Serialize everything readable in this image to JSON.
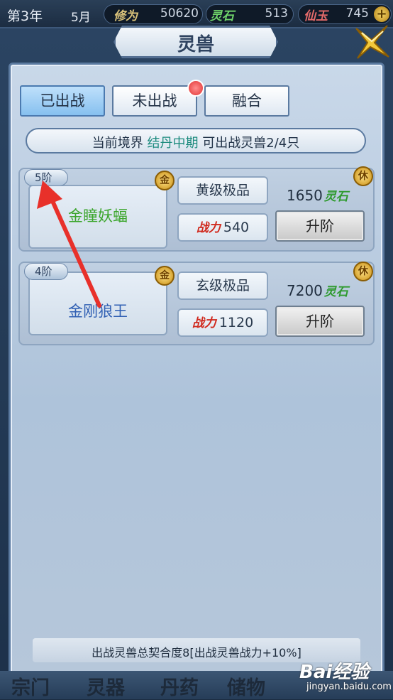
{
  "status_bar": {
    "year": "第3年",
    "month": "5月",
    "cultivation_label": "修为",
    "cultivation_value": "50620",
    "spirit_stone_label": "灵石",
    "spirit_stone_value": "513",
    "jade_label": "仙玉",
    "jade_value": "745",
    "add_symbol": "+"
  },
  "title": "灵兽",
  "tabs": [
    {
      "label": "已出战",
      "active": true
    },
    {
      "label": "未出战",
      "active": false,
      "has_notification": true
    },
    {
      "label": "融合",
      "active": false
    }
  ],
  "realm_banner": {
    "prefix": "当前境界",
    "realm": "结丹中期",
    "suffix": "可出战灵兽2/4只"
  },
  "beasts": [
    {
      "rank": "5阶",
      "name": "金瞳妖蝠",
      "name_color": "#3aa52a",
      "element": "金",
      "grade": "黄级极品",
      "power_label": "战力",
      "power": "540",
      "cost": "1650",
      "cost_unit": "灵石",
      "rest_label": "休",
      "upgrade_label": "升阶"
    },
    {
      "rank": "4阶",
      "name": "金刚狼王",
      "name_color": "#2f5fb3",
      "element": "金",
      "grade": "玄级极品",
      "power_label": "战力",
      "power": "1120",
      "cost": "7200",
      "cost_unit": "灵石",
      "rest_label": "休",
      "upgrade_label": "升阶"
    }
  ],
  "bond_text": "出战灵兽总契合度8[出战灵兽战力+10%]",
  "bottom_nav": [
    "宗门",
    "灵器",
    "丹药",
    "储物"
  ],
  "watermark": {
    "main": "Bai经验",
    "sub": "jingyan.baidu.com"
  },
  "colors": {
    "accent": "#5b7aa0",
    "highlight": "#1c8b7e",
    "arrow": "#e8302a"
  }
}
